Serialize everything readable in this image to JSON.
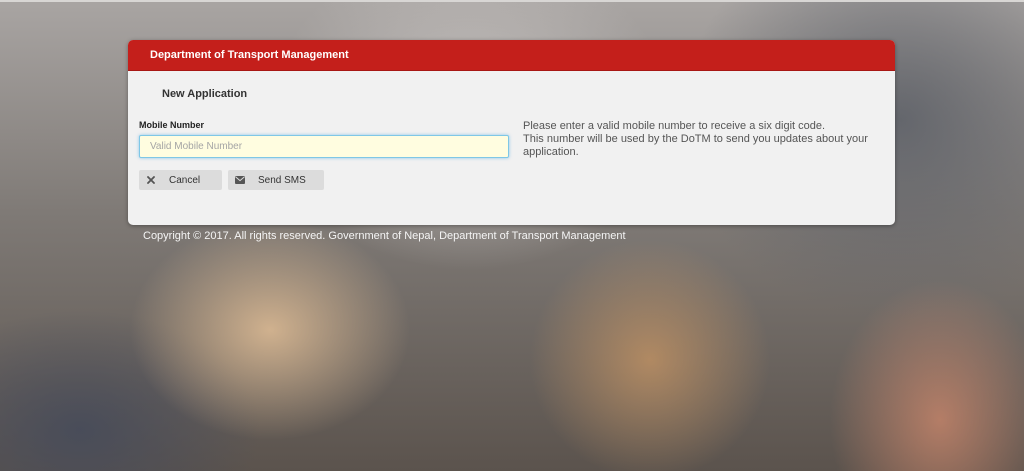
{
  "header": {
    "title": "Department of Transport Management"
  },
  "form": {
    "section_title": "New Application",
    "mobile_label": "Mobile Number",
    "mobile_placeholder": "Valid Mobile Number",
    "mobile_value": "",
    "cancel_label": "Cancel",
    "cancel_icon": "times-icon",
    "send_sms_label": "Send SMS",
    "send_sms_icon": "envelope-icon"
  },
  "help": {
    "line1": "Please enter a valid mobile number to receive a six digit code.",
    "line2": "This number will be used by the DoTM to send you updates about your application."
  },
  "footer": {
    "copyright": "Copyright © 2017. All rights reserved. Government of Nepal, Department of Transport Management"
  },
  "colors": {
    "header_bg": "#c41f1b",
    "panel_bg": "#f1f1f1",
    "input_bg": "#fffde0",
    "input_focus_border": "#7fc7e6"
  }
}
